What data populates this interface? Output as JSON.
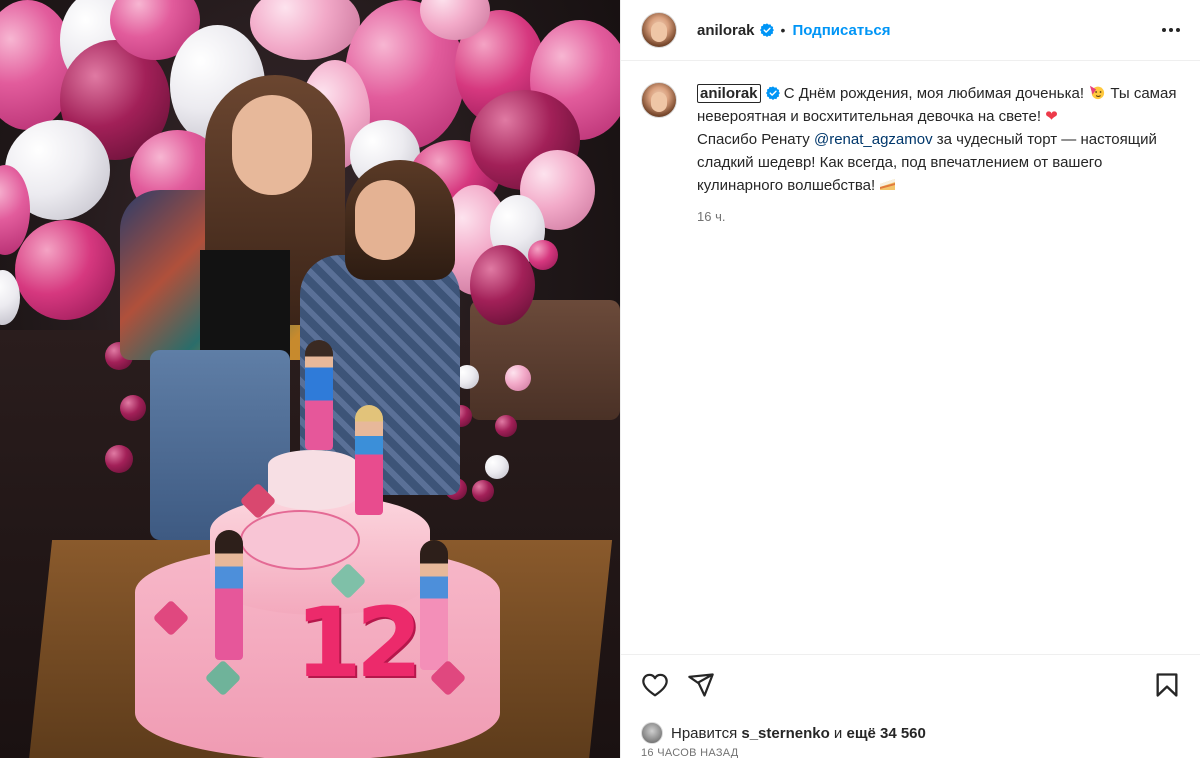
{
  "post": {
    "author": "anilorak",
    "follow_label": "Подписаться",
    "separator": "•",
    "caption": {
      "username": "anilorak",
      "part1": "С Днём рождения, моя любимая доченька!",
      "part2": "Ты самая невероятная и восхитительная девочка на свете!",
      "part3": "Спасибо Ренату",
      "mention": "@renat_agzamov",
      "part4": "за чудесный торт — настоящий сладкий шедевр! Как всегда, под впечатлением от вашего кулинарного волшебства!",
      "heart": "❤"
    },
    "time_ago": "16 ч.",
    "likes": {
      "prefix": "Нравится",
      "user": "s_sternenko",
      "connector": "и",
      "rest": "ещё 34 560"
    },
    "post_time": "16 ЧАСОВ НАЗАД",
    "cake_number": "12"
  },
  "icons": {
    "verified": "verified-badge-icon",
    "more": "more-options-icon",
    "like": "heart-icon",
    "share": "share-icon",
    "save": "bookmark-icon"
  },
  "colors": {
    "link": "#0095f6",
    "mention": "#00376b",
    "muted": "#737373",
    "heart": "#ed3a4a"
  }
}
